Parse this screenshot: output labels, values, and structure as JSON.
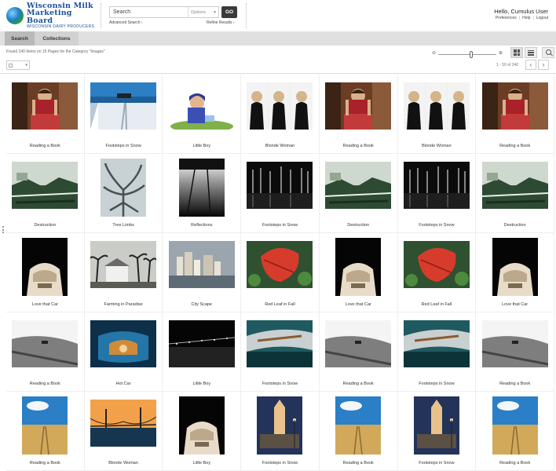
{
  "brand": {
    "line1": "Wisconsin Milk",
    "line2": "Marketing Board",
    "line3": "WISCONSIN DAIRY PRODUCERS"
  },
  "search": {
    "placeholder": "Search",
    "options_label": "Options",
    "go_label": "GO",
    "advanced_label": "Advanced Search ›",
    "refine_label": "Refine Results ›"
  },
  "user": {
    "greeting": "Hello, Cumulus User",
    "links": [
      "Preferences",
      "Help",
      "Logout"
    ]
  },
  "tabs": [
    "Search",
    "Collections"
  ],
  "results": {
    "found_text": "Found 240 Items on 15 Pages for the Category \"Images\"",
    "page_range": "1 - 50 of 240",
    "zoom_level": 0.57
  },
  "icons": {
    "grid_view": "grid-view-icon",
    "list_view": "list-view-icon",
    "preview": "magnifier-icon",
    "prev": "chevron-left-icon",
    "next": "chevron-right-icon"
  },
  "items": [
    {
      "caption": "Reading a Book",
      "kind": "reader"
    },
    {
      "caption": "Footsteps in Snow",
      "kind": "snow"
    },
    {
      "caption": "Little Boy",
      "kind": "boy"
    },
    {
      "caption": "Blonde Woman",
      "kind": "women"
    },
    {
      "caption": "Reading a Book",
      "kind": "reader"
    },
    {
      "caption": "Blonde Woman",
      "kind": "women"
    },
    {
      "caption": "Reading a Book",
      "kind": "reader"
    },
    {
      "caption": "Destruction",
      "kind": "destruction"
    },
    {
      "caption": "Tree Limbs",
      "kind": "tree"
    },
    {
      "caption": "Reflections",
      "kind": "reflections"
    },
    {
      "caption": "Footsteps in Snow",
      "kind": "forest"
    },
    {
      "caption": "Destruction",
      "kind": "destruction"
    },
    {
      "caption": "Footsteps in Snow",
      "kind": "forest"
    },
    {
      "caption": "Destruction",
      "kind": "destruction"
    },
    {
      "caption": "Love that Car",
      "kind": "car"
    },
    {
      "caption": "Farming in Paradise",
      "kind": "palms"
    },
    {
      "caption": "City Scape",
      "kind": "city"
    },
    {
      "caption": "Red Leaf in Fall",
      "kind": "leaf"
    },
    {
      "caption": "Love that Car",
      "kind": "car"
    },
    {
      "caption": "Red Leaf in Fall",
      "kind": "leaf"
    },
    {
      "caption": "Love that Car",
      "kind": "car"
    },
    {
      "caption": "Reading a Book",
      "kind": "field"
    },
    {
      "caption": "Hot Car",
      "kind": "hotcar"
    },
    {
      "caption": "Little Boy",
      "kind": "nightbridge"
    },
    {
      "caption": "Footsteps in Snow",
      "kind": "chrome"
    },
    {
      "caption": "Reading a Book",
      "kind": "field"
    },
    {
      "caption": "Footsteps in Snow",
      "kind": "chrome"
    },
    {
      "caption": "Reading a Book",
      "kind": "field"
    },
    {
      "caption": "Reading a Book",
      "kind": "road"
    },
    {
      "caption": "Blonde Woman",
      "kind": "bridge"
    },
    {
      "caption": "Little Boy",
      "kind": "car"
    },
    {
      "caption": "Footsteps in Snow",
      "kind": "tower"
    },
    {
      "caption": "Reading a Book",
      "kind": "road"
    },
    {
      "caption": "Footsteps in Snow",
      "kind": "tower"
    },
    {
      "caption": "Reading a Book",
      "kind": "road"
    }
  ]
}
